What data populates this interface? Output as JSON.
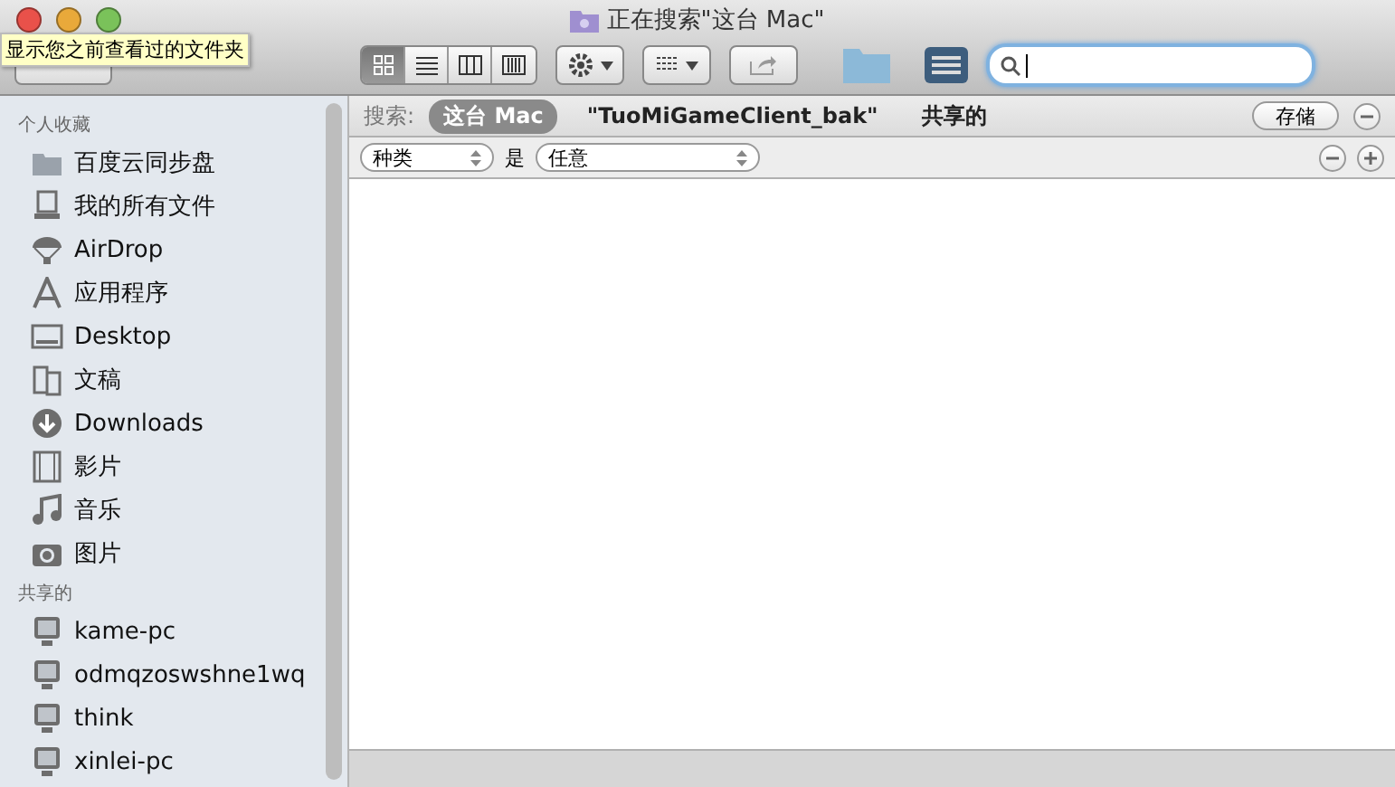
{
  "window": {
    "title": "正在搜索\"这台 Mac\""
  },
  "tooltip": "显示您之前查看过的文件夹",
  "toolbar": {
    "view_modes": [
      {
        "kind": "icons",
        "selected": true
      },
      {
        "kind": "list",
        "selected": false
      },
      {
        "kind": "columns",
        "selected": false
      },
      {
        "kind": "coverflow",
        "selected": false
      }
    ]
  },
  "sidebar": {
    "sections": [
      {
        "title": "个人收藏",
        "items": [
          {
            "label": "百度云同步盘",
            "kind": "folder"
          },
          {
            "label": "我的所有文件",
            "kind": "allfiles"
          },
          {
            "label": "AirDrop",
            "kind": "airdrop"
          },
          {
            "label": "应用程序",
            "kind": "apps"
          },
          {
            "label": "Desktop",
            "kind": "desktop"
          },
          {
            "label": "文稿",
            "kind": "documents"
          },
          {
            "label": "Downloads",
            "kind": "downloads"
          },
          {
            "label": "影片",
            "kind": "movies"
          },
          {
            "label": "音乐",
            "kind": "music"
          },
          {
            "label": "图片",
            "kind": "pictures"
          }
        ]
      },
      {
        "title": "共享的",
        "items": [
          {
            "label": "kame-pc",
            "kind": "computer"
          },
          {
            "label": "odmqzoswshne1wq",
            "kind": "computer"
          },
          {
            "label": "think",
            "kind": "computer"
          },
          {
            "label": "xinlei-pc",
            "kind": "computer"
          }
        ]
      }
    ]
  },
  "search_bar": {
    "label": "搜索:",
    "scopes": [
      {
        "label": "这台 Mac",
        "selected": true
      },
      {
        "label": "\"TuoMiGameClient_bak\"",
        "selected": false
      },
      {
        "label": "共享的",
        "selected": false
      }
    ],
    "save": "存储"
  },
  "criteria": {
    "attribute": "种类",
    "operator": "是",
    "value": "任意"
  }
}
